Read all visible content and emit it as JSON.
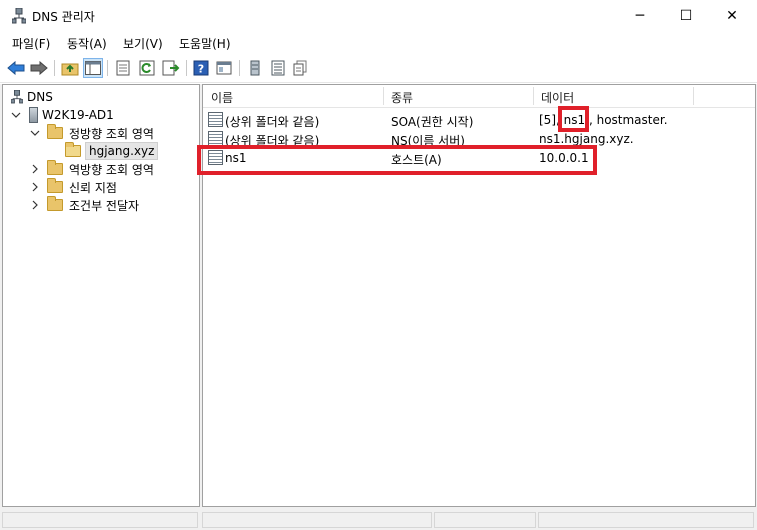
{
  "window": {
    "title": "DNS 관리자",
    "controls": {
      "minimize": "─",
      "maximize": "☐",
      "close": "✕"
    }
  },
  "menu": [
    "파일(F)",
    "동작(A)",
    "보기(V)",
    "도움말(H)"
  ],
  "toolbar": {
    "buttons": [
      "back-arrow-icon",
      "forward-arrow-icon",
      "up-folder-icon",
      "show-tree-icon",
      "properties-icon",
      "refresh-icon",
      "export-icon",
      "help-icon",
      "console-icon",
      "server-icon",
      "list-icon",
      "copy-icon"
    ]
  },
  "tree": {
    "root": "DNS",
    "server": "W2K19-AD1",
    "forward_zones": "정방향 조회 영역",
    "zone": "hgjang.xyz",
    "reverse_zones": "역방향 조회 영역",
    "trust_points": "신뢰 지점",
    "conditional_forwarders": "조건부 전달자"
  },
  "list": {
    "columns": [
      "이름",
      "종류",
      "데이터"
    ],
    "rows": [
      {
        "name": "(상위 폴더와 같음)",
        "type": "SOA(권한 시작)",
        "data_prefix": "[5], ",
        "data_highlight": "ns1.",
        "data_suffix": ", hostmaster."
      },
      {
        "name": "(상위 폴더와 같음)",
        "type": "NS(이름 서버)",
        "data": "ns1.hgjang.xyz."
      },
      {
        "name": "ns1",
        "type": "호스트(A)",
        "data": "10.0.0.1"
      }
    ]
  },
  "colors": {
    "highlight": "#e0202a",
    "folder": "#e9c46a",
    "help": "#2b5fb4"
  }
}
